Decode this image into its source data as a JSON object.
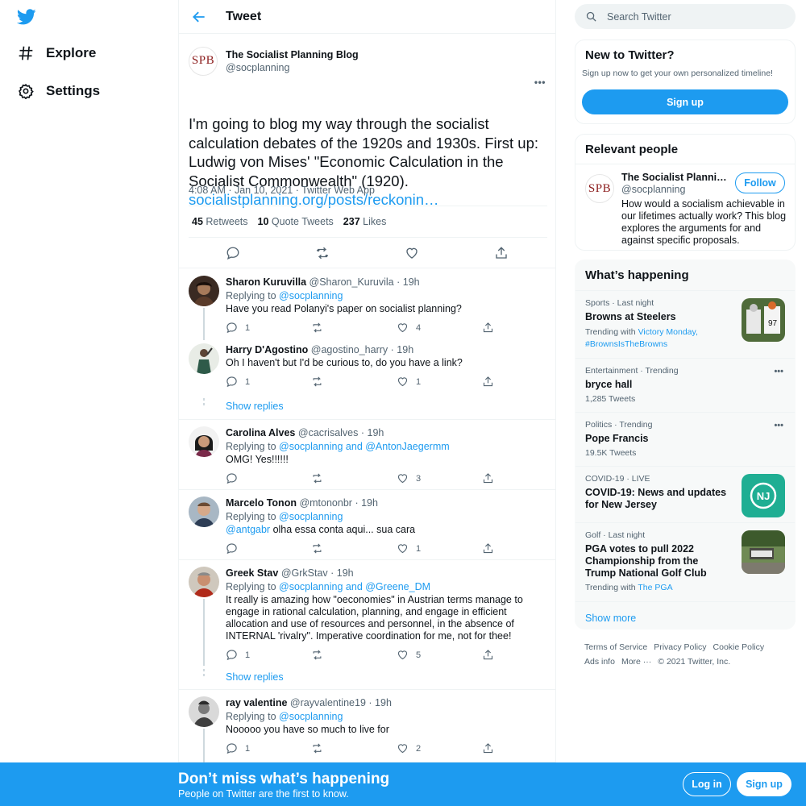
{
  "nav": {
    "explore": "Explore",
    "settings": "Settings"
  },
  "header": {
    "title": "Tweet"
  },
  "main_tweet": {
    "avatar_text": "SPB",
    "name": "The Socialist Planning Blog",
    "handle": "@socplanning",
    "text": "I'm going to blog my way through the socialist calculation debates of the 1920s and 1930s. First up: Ludwig von Mises' \"Economic Calculation in the Socialist Commonwealth\" (1920).",
    "link": "socialistplanning.org/posts/reckonin…",
    "meta": "4:08 AM · Jan 10, 2021 · Twitter Web App",
    "retweets": {
      "count": "45",
      "label": "Retweets"
    },
    "quotes": {
      "count": "10",
      "label": "Quote Tweets"
    },
    "likes": {
      "count": "237",
      "label": "Likes"
    }
  },
  "replies": [
    {
      "name": "Sharon Kuruvilla",
      "handle": "@Sharon_Kuruvila",
      "time": "· 19h",
      "replying_prefix": "Replying to",
      "replying_to": "@socplanning",
      "text": "Have you read Polanyi's paper on socialist planning?",
      "replies": "1",
      "likes": "4"
    },
    {
      "name": "Harry D'Agostino",
      "handle": "@agostino_harry",
      "time": "· 19h",
      "text": "Oh I haven't but I'd be curious to, do you have a link?",
      "replies": "1",
      "likes": "1"
    },
    {
      "show_replies": "Show replies"
    },
    {
      "name": "Carolina Alves",
      "handle": "@cacrisalves",
      "time": "· 19h",
      "replying_prefix": "Replying to",
      "replying_to": "@socplanning and @AntonJaegermm",
      "text": "OMG! Yes!!!!!!",
      "replies": "",
      "likes": "3"
    },
    {
      "name": "Marcelo Tonon",
      "handle": "@mtononbr",
      "time": "· 19h",
      "replying_prefix": "Replying to",
      "replying_to": "@socplanning",
      "mention": "@antgabr",
      "text": " olha essa conta aqui... sua cara",
      "replies": "",
      "likes": "1"
    },
    {
      "name": "Greek Stav",
      "handle": "@GrkStav",
      "time": "· 19h",
      "replying_prefix": "Replying to",
      "replying_to": "@socplanning and @Greene_DM",
      "text": "It really is amazing how \"oeconomies\" in Austrian terms manage to engage in rational calculation, planning, and engage in efficient allocation and use of resources and personnel, in the absence of INTERNAL 'rivalry\". Imperative coordination for me, not for thee!",
      "replies": "1",
      "likes": "5"
    },
    {
      "show_replies": "Show replies"
    },
    {
      "name": "ray valentine",
      "handle": "@rayvalentine19",
      "time": "· 19h",
      "replying_prefix": "Replying to",
      "replying_to": "@socplanning",
      "text": "Nooooo you have so much to live for",
      "replies": "1",
      "likes": "2"
    }
  ],
  "search": {
    "placeholder": "Search Twitter"
  },
  "new_to_twitter": {
    "title": "New to Twitter?",
    "subtitle": "Sign up now to get your own personalized timeline!",
    "button": "Sign up"
  },
  "relevant_people": {
    "title": "Relevant people",
    "avatar_text": "SPB",
    "name": "The Socialist Planning Blog",
    "handle": "@socplanning",
    "follow": "Follow",
    "bio": "How would a socialism achievable in our lifetimes actually work? This blog explores the arguments for and against specific proposals."
  },
  "whats_happening": {
    "title": "What’s happening",
    "trends": [
      {
        "category": "Sports · Last night",
        "title": "Browns at Steelers",
        "sub_prefix": "Trending with",
        "sub_links": "Victory Monday, #BrownsIsTheBrowns"
      },
      {
        "category": "Entertainment · Trending",
        "title": "bryce hall",
        "sub": "1,285 Tweets"
      },
      {
        "category": "Politics · Trending",
        "title": "Pope Francis",
        "sub": "19.5K Tweets"
      },
      {
        "category": "COVID-19 · LIVE",
        "title": "COVID-19: News and updates for New Jersey",
        "thumb_text": "NJ"
      },
      {
        "category": "Golf · Last night",
        "title": "PGA votes to pull 2022 Championship from the Trump National Golf Club",
        "sub_prefix": "Trending with",
        "sub_links": "The PGA"
      }
    ],
    "show_more": "Show more"
  },
  "footer": {
    "terms": "Terms of Service",
    "privacy": "Privacy Policy",
    "cookie": "Cookie Policy",
    "ads": "Ads info",
    "more": "More ···",
    "copyright": "© 2021 Twitter, Inc."
  },
  "bottom_bar": {
    "title": "Don’t miss what’s happening",
    "subtitle": "People on Twitter are the first to know.",
    "login": "Log in",
    "signup": "Sign up"
  }
}
